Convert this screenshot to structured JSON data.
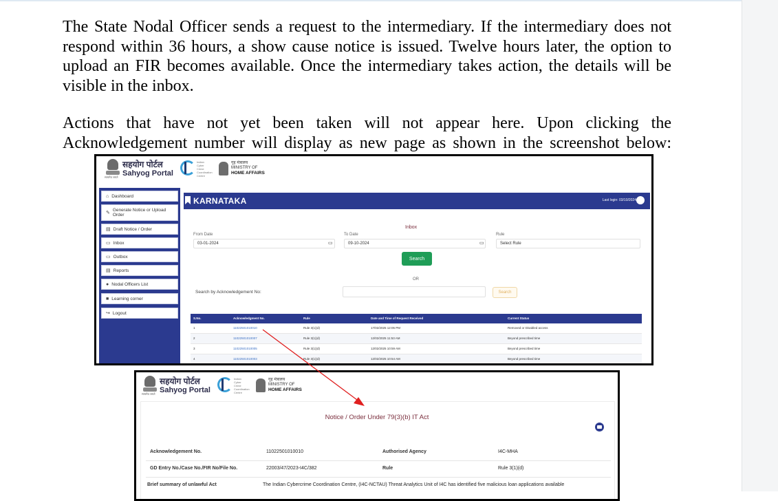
{
  "document": {
    "paragraph1": "The State Nodal Officer sends a request to the intermediary. If the intermediary does not respond within 36 hours, a show cause notice is issued. Twelve hours later, the option to upload an FIR becomes available. Once the intermediary takes action, the details will be visible in the inbox.",
    "paragraph2": "Actions that have not yet been taken will not appear here. Upon clicking the Acknowledgement number will display as new page as shown in the screenshot below:"
  },
  "portal": {
    "brand_hindi": "सहयोग पोर्टल",
    "brand_english": "Sahyog Portal",
    "emblem_caption": "सत्यमेव जयते",
    "i4c_lines": [
      "Indian",
      "Cyber",
      "Crime",
      "Coordination",
      "Centre"
    ],
    "mha_hindi": "गृह मंत्रालय",
    "mha_line1": "MINISTRY OF",
    "mha_line2": "HOME AFFAIRS"
  },
  "sidebar": {
    "items": [
      {
        "icon": "dashboard-icon",
        "label": "Dashboard"
      },
      {
        "icon": "edit-icon",
        "label": "Generate Notice or Upload Order"
      },
      {
        "icon": "document-icon",
        "label": "Draft Notice / Order"
      },
      {
        "icon": "inbox-icon",
        "label": "Inbox"
      },
      {
        "icon": "outbox-icon",
        "label": "Outbox"
      },
      {
        "icon": "report-icon",
        "label": "Reports"
      },
      {
        "icon": "user-icon",
        "label": "Nodal Officers List"
      },
      {
        "icon": "learning-icon",
        "label": "Learning corner"
      },
      {
        "icon": "logout-icon",
        "label": "Logout"
      }
    ]
  },
  "inbox": {
    "state_title": "KARNATAKA",
    "last_login": "Last login: 03/10/2024",
    "section_title": "Inbox",
    "from_label": "From Date",
    "from_value": "03-01-2024",
    "to_label": "To Date",
    "to_value": "09-10-2024",
    "rule_label": "Rule",
    "rule_placeholder": "Select Rule",
    "search_button": "Search",
    "or_text": "OR",
    "ack_search_label": "Search by Acknowledgement No:",
    "ack_search_button": "Search",
    "table": {
      "headers": [
        "S.No.",
        "Acknowledgment No.",
        "Rule",
        "Date and Time of Request Received",
        "Current Status"
      ],
      "rows": [
        [
          "1",
          "11022501010010",
          "Rule 3(1)(d)",
          "17/02/2025 12:05 PM",
          "Removed or Disabled access"
        ],
        [
          "2",
          "11022501010007",
          "Rule 3(1)(d)",
          "12/02/2025 11:53 AM",
          "Beyond prescribed time"
        ],
        [
          "3",
          "11022501010005",
          "Rule 3(1)(d)",
          "12/02/2025 10:59 AM",
          "Beyond prescribed time"
        ],
        [
          "4",
          "11022501010003",
          "Rule 3(1)(d)",
          "12/02/2025 10:54 AM",
          "Beyond prescribed time"
        ]
      ]
    }
  },
  "notice": {
    "title": "Notice / Order Under 79(3)(b) IT Act",
    "ack_label": "Acknowledgement No.",
    "ack_value": "11022501010010",
    "agency_label": "Authorised Agency",
    "agency_value": "I4C-MHA",
    "gd_label": "GD Entry No./Case No./FIR No/File No.",
    "gd_value": "22003/47/2023-I4C/382",
    "rule_label": "Rule",
    "rule_value": "Rule 3(1)(d)",
    "summary_label": "Brief summary of unlawful Act",
    "summary_value": "The Indian Cybercrime Coordination Centre, (I4C-NCTAU) Threat Analytics Unit of I4C has identified five malicious loan applications available"
  },
  "colors": {
    "portal_blue": "#2b3a8f",
    "search_green": "#1f9d57",
    "notice_title": "#7a2d3c",
    "arrow_red": "#e02020"
  }
}
